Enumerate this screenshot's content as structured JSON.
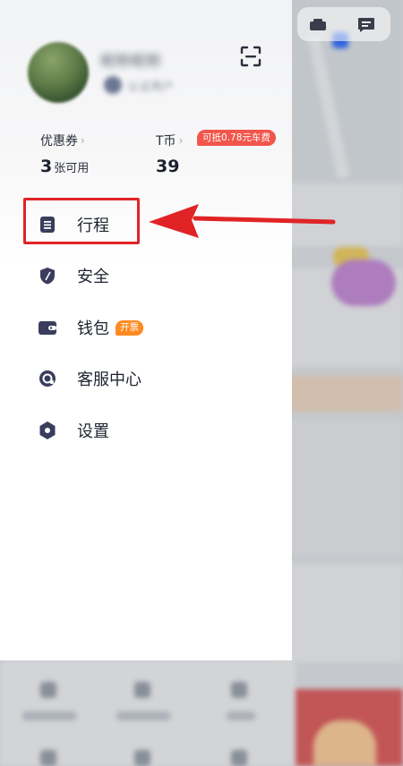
{
  "profile": {
    "name": "昵称昵称",
    "subtitle": "认证用户"
  },
  "stats": {
    "coupons": {
      "label": "优惠券",
      "count": "3",
      "unit": "张可用"
    },
    "tcoins": {
      "label": "T币",
      "value": "39",
      "badge": "可抵0.78元车费"
    }
  },
  "menu": [
    {
      "label": "行程",
      "icon": "document-icon"
    },
    {
      "label": "安全",
      "icon": "shield-icon"
    },
    {
      "label": "钱包",
      "icon": "wallet-icon",
      "badge": "开票"
    },
    {
      "label": "客服中心",
      "icon": "headset-icon"
    },
    {
      "label": "设置",
      "icon": "settings-hexagon-icon"
    }
  ],
  "annotation": {
    "highlight_color": "#e02426",
    "target": "行程"
  },
  "colors": {
    "icon": "#3a3d5c",
    "badge_red": "#f2554b",
    "badge_orange": "#ff8a1f"
  }
}
